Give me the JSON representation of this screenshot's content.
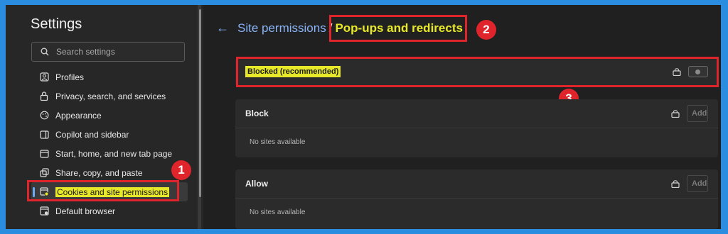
{
  "sidebar": {
    "title": "Settings",
    "search_placeholder": "Search settings",
    "items": [
      {
        "label": "Profiles",
        "icon": "profile-icon"
      },
      {
        "label": "Privacy, search, and services",
        "icon": "lock-icon"
      },
      {
        "label": "Appearance",
        "icon": "appearance-icon"
      },
      {
        "label": "Copilot and sidebar",
        "icon": "sidebar-icon"
      },
      {
        "label": "Start, home, and new tab page",
        "icon": "home-icon"
      },
      {
        "label": "Share, copy, and paste",
        "icon": "share-icon"
      },
      {
        "label": "Cookies and site permissions",
        "icon": "cookies-icon",
        "active": true
      },
      {
        "label": "Default browser",
        "icon": "browser-icon"
      }
    ]
  },
  "breadcrumb": {
    "parent": "Site permissions",
    "separator": "/",
    "current": "Pop-ups and redirects"
  },
  "blocked_card": {
    "label": "Blocked (recommended)",
    "toggle_on": false
  },
  "block_card": {
    "title": "Block",
    "empty": "No sites available",
    "add_label": "Add"
  },
  "allow_card": {
    "title": "Allow",
    "empty": "No sites available",
    "add_label": "Add"
  },
  "badges": {
    "one": "1",
    "two": "2",
    "three": "3"
  },
  "colors": {
    "accent": "#8ab4f8",
    "highlight": "#e8e82a",
    "annotation_red": "#e0242b",
    "frame_blue": "#2b8ddf"
  }
}
